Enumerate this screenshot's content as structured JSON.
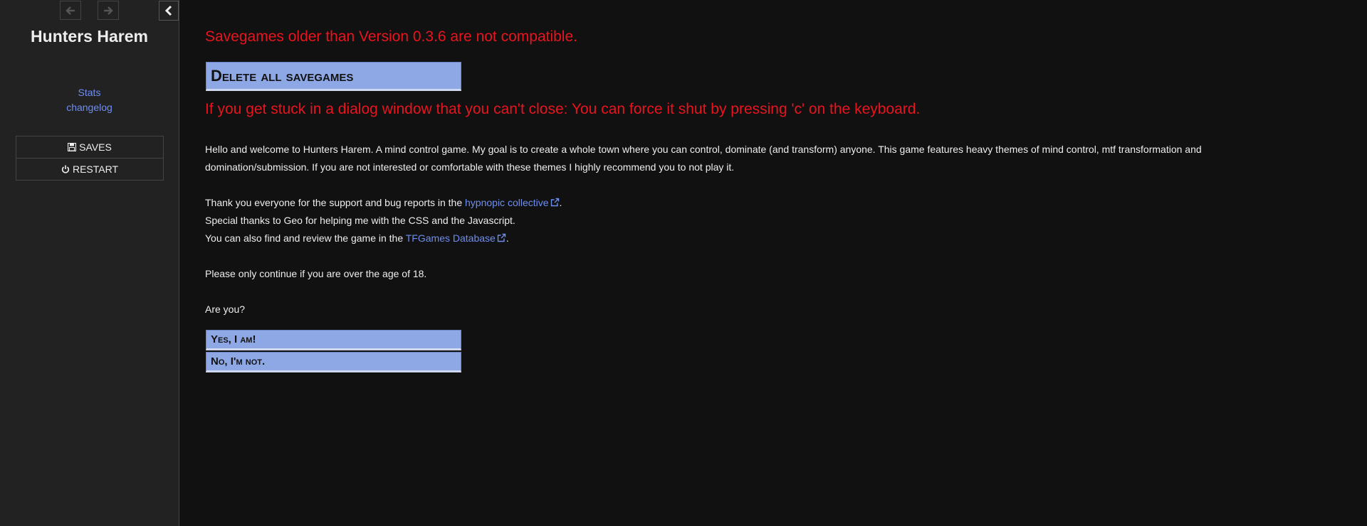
{
  "sidebar": {
    "title": "Hunters Harem",
    "links": {
      "stats": "Stats",
      "changelog": "changelog"
    },
    "menu": {
      "saves_label": "SAVES",
      "restart_label": "RESTART"
    },
    "icons": {
      "back": "arrow-left-icon",
      "forward": "arrow-right-icon",
      "collapse": "chevron-left-icon",
      "saves": "floppy-disk-icon",
      "restart": "power-icon"
    }
  },
  "passage": {
    "warning_compat": "Savegames older than Version 0.3.6 are not compatible.",
    "delete_button": "Delete all savegames",
    "warning_stuck": "If you get stuck in a dialog window that you can't close: You can force it shut by pressing 'c' on the keyboard.",
    "intro": "Hello and welcome to Hunters Harem. A mind control game. My goal is to create a whole town where you can control, dominate (and transform) anyone. This game features heavy themes of mind control, mtf transformation and domination/submission. If you are not interested or comfortable with these themes I highly recommend you to not play it.",
    "thanks1_before": "Thank you everyone for the support and bug reports in the ",
    "thanks1_link": "hypnopic collective",
    "thanks1_after": ".",
    "thanks2": "Special thanks to Geo for helping me with the CSS and the Javascript.",
    "thanks3_before": "You can also find and review the game in the ",
    "thanks3_link": "TFGames Database",
    "thanks3_after": ".",
    "age_note": "Please only continue if you are over the age of 18.",
    "question": "Are you?",
    "yes_button": "Yes, I am!",
    "no_button": "No, I'm not."
  },
  "colors": {
    "background": "#111111",
    "sidebar": "#222222",
    "warning": "#e8141e",
    "link": "#6f8ef0",
    "button": "#8ea8e6"
  }
}
